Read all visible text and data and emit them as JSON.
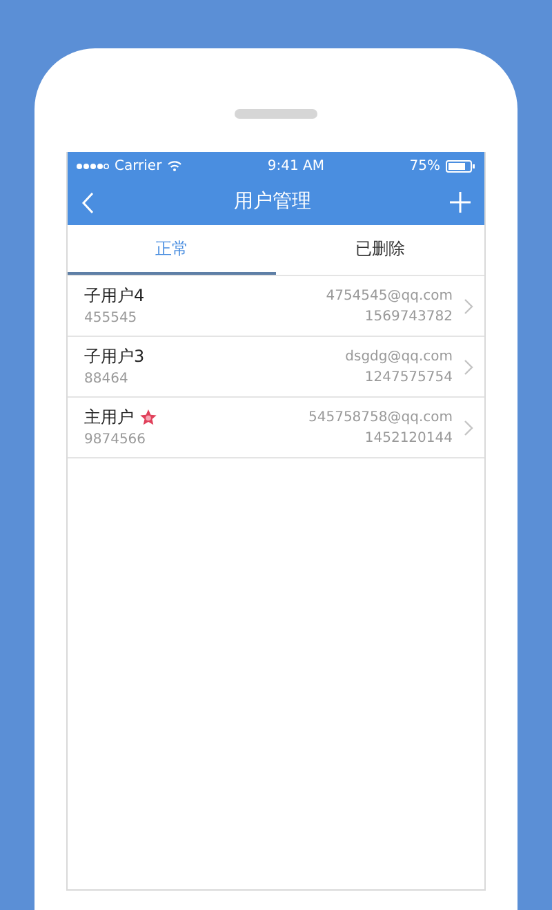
{
  "status_bar": {
    "carrier": "Carrier",
    "time": "9:41 AM",
    "battery": "75%"
  },
  "nav_bar": {
    "title": "用户管理"
  },
  "tabs": [
    {
      "label": "正常",
      "selected": true
    },
    {
      "label": "已删除",
      "selected": false
    }
  ],
  "users": [
    {
      "name": "子用户4",
      "id": "455545",
      "email": "4754545@qq.com",
      "phone": "1569743782",
      "primary": false
    },
    {
      "name": "子用户3",
      "id": "88464",
      "email": "dsgdg@qq.com",
      "phone": "1247575754",
      "primary": false
    },
    {
      "name": "主用户",
      "id": "9874566",
      "email": "545758758@qq.com",
      "phone": "1452120144",
      "primary": true
    }
  ]
}
